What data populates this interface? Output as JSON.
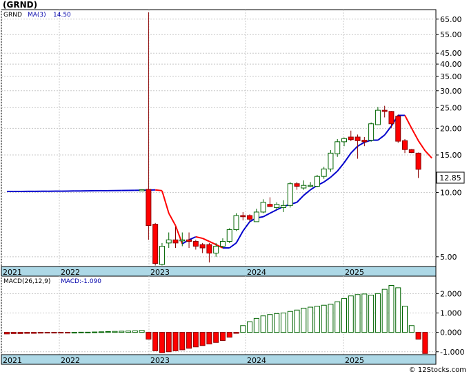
{
  "title": "(GRND)",
  "copyright": "© 12Stocks.com",
  "legend_price": {
    "symbol": "GRND",
    "ma_label": "MA(3)",
    "ma_value": "14.50"
  },
  "legend_macd": {
    "label": "MACD(26,12,9)",
    "value_label": "MACD:-1.090"
  },
  "last_price_label": "12.85",
  "colors": {
    "up": "#006400",
    "down": "#ff0000",
    "ma_rising": "#0000cc",
    "ma_falling": "#ff0000",
    "axis_band": "#add8e6",
    "grid": "#c8c8c8",
    "text": "#000000",
    "label_text": "#0000aa"
  },
  "chart_data": [
    {
      "type": "candlestick",
      "yscale": "log",
      "ylim": [
        4.5,
        72
      ],
      "yticks": [
        "5.00",
        "10.00",
        "15.00",
        "20.00",
        "25.00",
        "30.00",
        "35.00",
        "40.00",
        "45.00",
        "55.00",
        "65.00"
      ],
      "xticks": [
        "2021",
        "2022",
        "2023",
        "2024",
        "2025"
      ],
      "candles": [
        {
          "o": 10.12,
          "h": 10.12,
          "l": 10.12,
          "c": 10.12
        },
        {
          "o": 10.12,
          "h": 10.12,
          "l": 10.12,
          "c": 10.12
        },
        {
          "o": 10.13,
          "h": 10.13,
          "l": 10.13,
          "c": 10.13
        },
        {
          "o": 10.13,
          "h": 10.13,
          "l": 10.13,
          "c": 10.13
        },
        {
          "o": 10.14,
          "h": 10.14,
          "l": 10.14,
          "c": 10.14
        },
        {
          "o": 10.14,
          "h": 10.14,
          "l": 10.14,
          "c": 10.14
        },
        {
          "o": 10.15,
          "h": 10.15,
          "l": 10.15,
          "c": 10.15
        },
        {
          "o": 10.15,
          "h": 10.15,
          "l": 10.15,
          "c": 10.15
        },
        {
          "o": 10.16,
          "h": 10.16,
          "l": 10.16,
          "c": 10.16
        },
        {
          "o": 10.17,
          "h": 10.17,
          "l": 10.17,
          "c": 10.17
        },
        {
          "o": 10.17,
          "h": 10.17,
          "l": 10.17,
          "c": 10.17
        },
        {
          "o": 10.18,
          "h": 10.18,
          "l": 10.18,
          "c": 10.18
        },
        {
          "o": 10.19,
          "h": 10.19,
          "l": 10.19,
          "c": 10.19
        },
        {
          "o": 10.2,
          "h": 10.2,
          "l": 10.2,
          "c": 10.2
        },
        {
          "o": 10.2,
          "h": 10.2,
          "l": 10.2,
          "c": 10.2
        },
        {
          "o": 10.21,
          "h": 10.21,
          "l": 10.21,
          "c": 10.21
        },
        {
          "o": 10.22,
          "h": 10.22,
          "l": 10.22,
          "c": 10.22
        },
        {
          "o": 10.23,
          "h": 10.23,
          "l": 10.23,
          "c": 10.23
        },
        {
          "o": 10.24,
          "h": 10.24,
          "l": 10.24,
          "c": 10.24
        },
        {
          "o": 10.25,
          "h": 10.25,
          "l": 10.25,
          "c": 10.25
        },
        {
          "o": 10.28,
          "h": 10.32,
          "l": 10.2,
          "c": 10.3
        },
        {
          "o": 10.35,
          "h": 70.0,
          "l": 6.0,
          "c": 7.0
        },
        {
          "o": 7.1,
          "h": 7.2,
          "l": 4.55,
          "c": 4.65
        },
        {
          "o": 4.6,
          "h": 5.8,
          "l": 4.55,
          "c": 5.6
        },
        {
          "o": 5.8,
          "h": 6.5,
          "l": 5.5,
          "c": 6.0
        },
        {
          "o": 6.0,
          "h": 6.9,
          "l": 5.5,
          "c": 5.8
        },
        {
          "o": 6.0,
          "h": 6.5,
          "l": 5.6,
          "c": 6.0
        },
        {
          "o": 6.0,
          "h": 6.5,
          "l": 5.5,
          "c": 5.9
        },
        {
          "o": 5.9,
          "h": 6.0,
          "l": 5.4,
          "c": 5.6
        },
        {
          "o": 5.7,
          "h": 5.8,
          "l": 5.2,
          "c": 5.5
        },
        {
          "o": 5.7,
          "h": 5.8,
          "l": 4.7,
          "c": 5.2
        },
        {
          "o": 5.2,
          "h": 5.8,
          "l": 5.0,
          "c": 5.6
        },
        {
          "o": 5.6,
          "h": 6.1,
          "l": 5.5,
          "c": 5.9
        },
        {
          "o": 5.9,
          "h": 6.8,
          "l": 5.8,
          "c": 6.7
        },
        {
          "o": 6.7,
          "h": 8.0,
          "l": 6.6,
          "c": 7.8
        },
        {
          "o": 7.8,
          "h": 8.1,
          "l": 7.4,
          "c": 7.7
        },
        {
          "o": 7.8,
          "h": 7.9,
          "l": 7.3,
          "c": 7.5
        },
        {
          "o": 7.3,
          "h": 8.4,
          "l": 7.3,
          "c": 8.1
        },
        {
          "o": 8.1,
          "h": 9.3,
          "l": 8.0,
          "c": 9.0
        },
        {
          "o": 8.8,
          "h": 9.5,
          "l": 8.6,
          "c": 8.6
        },
        {
          "o": 8.5,
          "h": 9.0,
          "l": 8.3,
          "c": 8.8
        },
        {
          "o": 8.5,
          "h": 9.2,
          "l": 8.1,
          "c": 8.7
        },
        {
          "o": 8.7,
          "h": 11.2,
          "l": 8.5,
          "c": 11.0
        },
        {
          "o": 11.0,
          "h": 11.2,
          "l": 10.3,
          "c": 10.7
        },
        {
          "o": 10.5,
          "h": 11.4,
          "l": 10.3,
          "c": 10.8
        },
        {
          "o": 10.8,
          "h": 11.2,
          "l": 10.6,
          "c": 10.8
        },
        {
          "o": 10.7,
          "h": 12.1,
          "l": 10.6,
          "c": 11.9
        },
        {
          "o": 11.9,
          "h": 13.2,
          "l": 11.6,
          "c": 12.9
        },
        {
          "o": 12.9,
          "h": 15.8,
          "l": 12.5,
          "c": 15.3
        },
        {
          "o": 15.2,
          "h": 17.8,
          "l": 14.7,
          "c": 17.3
        },
        {
          "o": 17.3,
          "h": 18.1,
          "l": 16.5,
          "c": 17.9
        },
        {
          "o": 18.2,
          "h": 19.5,
          "l": 17.4,
          "c": 17.7
        },
        {
          "o": 18.2,
          "h": 18.7,
          "l": 14.4,
          "c": 17.5
        },
        {
          "o": 17.6,
          "h": 18.2,
          "l": 16.5,
          "c": 17.3
        },
        {
          "o": 17.6,
          "h": 21.3,
          "l": 17.3,
          "c": 21.0
        },
        {
          "o": 20.8,
          "h": 25.2,
          "l": 20.7,
          "c": 24.3
        },
        {
          "o": 24.3,
          "h": 25.5,
          "l": 22.5,
          "c": 24.0
        },
        {
          "o": 24.0,
          "h": 24.1,
          "l": 20.1,
          "c": 21.0
        },
        {
          "o": 22.8,
          "h": 23.2,
          "l": 17.1,
          "c": 17.4
        },
        {
          "o": 17.5,
          "h": 17.8,
          "l": 15.3,
          "c": 15.9
        },
        {
          "o": 15.9,
          "h": 16.0,
          "l": 15.3,
          "c": 15.4
        },
        {
          "o": 15.3,
          "h": 15.4,
          "l": 11.7,
          "c": 12.85
        }
      ],
      "ma": [
        10.12,
        10.12,
        10.12,
        10.13,
        10.13,
        10.14,
        10.14,
        10.15,
        10.15,
        10.16,
        10.17,
        10.17,
        10.18,
        10.19,
        10.2,
        10.2,
        10.21,
        10.22,
        10.23,
        10.24,
        10.25,
        10.27,
        10.29,
        10.2,
        8.0,
        7.0,
        5.75,
        6.0,
        6.2,
        6.1,
        5.9,
        5.7,
        5.5,
        5.5,
        5.8,
        6.6,
        7.3,
        7.6,
        7.7,
        8.0,
        8.3,
        8.6,
        8.8,
        9.0,
        9.7,
        10.3,
        10.8,
        11.2,
        11.8,
        12.6,
        13.8,
        15.3,
        16.5,
        17.2,
        17.6,
        17.6,
        18.6,
        20.5,
        23.0,
        23.0,
        20.0,
        17.5,
        15.7,
        14.5
      ],
      "last_price": 12.85
    },
    {
      "type": "bar",
      "title": "MACD(26,12,9)",
      "ylim": [
        -1.15,
        2.9
      ],
      "yticks": [
        "2.000",
        "1.000",
        "0.000",
        "-1.000"
      ],
      "xticks": [
        "2021",
        "2022",
        "2023",
        "2024",
        "2025"
      ],
      "values": [
        -0.08,
        -0.06,
        -0.06,
        -0.05,
        -0.05,
        -0.04,
        -0.03,
        -0.03,
        -0.02,
        -0.01,
        0.0,
        0.01,
        0.01,
        0.02,
        0.03,
        0.04,
        0.05,
        0.06,
        0.07,
        0.08,
        0.1,
        -0.35,
        -0.95,
        -1.05,
        -1.0,
        -0.95,
        -0.9,
        -0.82,
        -0.75,
        -0.68,
        -0.6,
        -0.52,
        -0.42,
        -0.25,
        -0.05,
        0.35,
        0.55,
        0.72,
        0.85,
        0.92,
        0.97,
        1.0,
        1.08,
        1.15,
        1.25,
        1.3,
        1.35,
        1.4,
        1.45,
        1.58,
        1.75,
        1.88,
        1.95,
        1.98,
        1.92,
        2.0,
        2.22,
        2.42,
        2.3,
        1.35,
        0.35,
        -0.35,
        -1.09
      ]
    }
  ]
}
